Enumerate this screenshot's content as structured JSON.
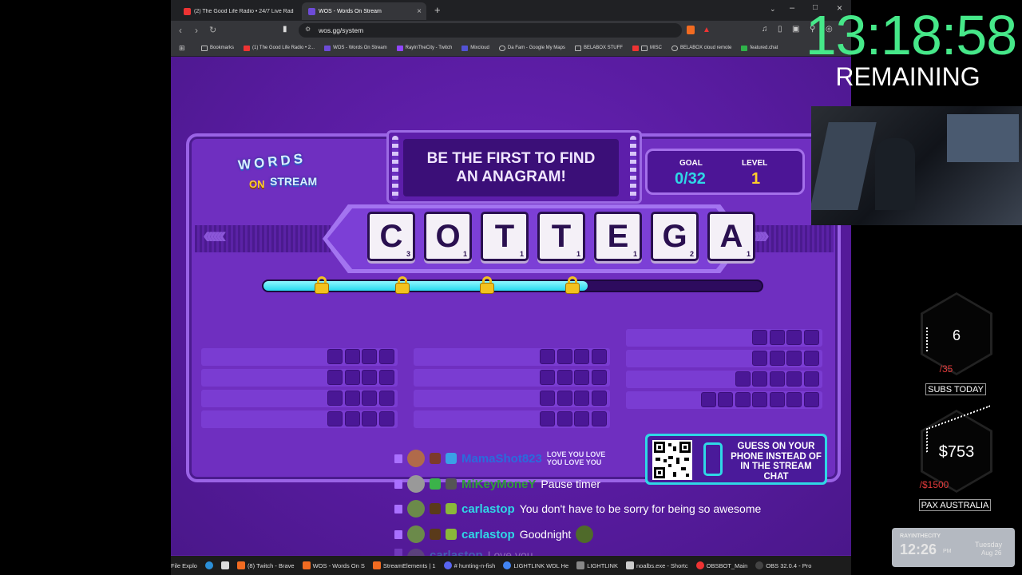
{
  "browser": {
    "tabs": [
      {
        "label": "(2) The Good Life Radio • 24/7 Live Radio | I",
        "active": false
      },
      {
        "label": "WOS - Words On Stream",
        "active": true
      }
    ],
    "new_tab_label": "+",
    "url": "wos.gg/system",
    "bookmarks": [
      "Bookmarks",
      "(1) The Good Life Radio • 2...",
      "WOS - Words On Stream",
      "RayInTheCity - Twitch",
      "Mixcloud",
      "Da Fam - Google My Maps",
      "BELABOX STUFF",
      "MISC",
      "BELABOX cloud remote",
      "featured.chat"
    ]
  },
  "game": {
    "logo_top": "WORDS",
    "logo_bottom_on": "ON",
    "logo_bottom_stream": "STREAM",
    "banner_text": "BE THE FIRST TO FIND AN ANAGRAM!",
    "goal_label": "GOAL",
    "goal_value": "0/32",
    "level_label": "LEVEL",
    "level_value": "1",
    "letters": [
      {
        "ch": "C",
        "pts": "3"
      },
      {
        "ch": "O",
        "pts": "1"
      },
      {
        "ch": "T",
        "pts": "1"
      },
      {
        "ch": "T",
        "pts": "1"
      },
      {
        "ch": "E",
        "pts": "1"
      },
      {
        "ch": "G",
        "pts": "2"
      },
      {
        "ch": "A",
        "pts": "1"
      }
    ],
    "progress_fraction": 0.65,
    "qr_text": "GUESS ON YOUR PHONE INSTEAD OF IN THE STREAM CHAT"
  },
  "chat": [
    {
      "user": "MamaShot823",
      "message": "LOVE YOU LOVE YOU LOVE YOU",
      "user_color": "#2a6bdc"
    },
    {
      "user": "MiKeyMoneY",
      "message": "Pause timer",
      "user_color": "#2f9e3a"
    },
    {
      "user": "carlastop",
      "message": "You don't have to be sorry for being so awesome",
      "user_color": "#2fd7e6"
    },
    {
      "user": "carlastop",
      "message": "Goodnight",
      "user_color": "#2fd7e6"
    },
    {
      "user": "carlastop",
      "message": "Love you",
      "user_color": "#2fd7e6"
    }
  ],
  "taskbar": [
    "File Explo",
    "(8) Twitch - Brave",
    "WOS - Words On S",
    "StreamElements | 1",
    "# hunting-n-fish",
    "LIGHTLINK WDL He",
    "LIGHTLINK",
    "noalbs.exe - Shortc",
    "OBSBOT_Main",
    "OBS 32.0.4 - Pro"
  ],
  "overlay": {
    "timer": "13:18:58",
    "remaining": "REMAINING",
    "subs_count": "6",
    "subs_goal": "/35",
    "subs_label": "SUBS TODAY",
    "money": "$753",
    "money_goal": "/$1500",
    "money_label": "PAX AUSTRALIA",
    "clock_brand": "RAYINTHECITY",
    "clock_time": "12:26",
    "clock_ampm": "PM",
    "clock_day": "Tuesday",
    "clock_date": "Aug 26"
  },
  "colors": {
    "timer_green": "#46e889",
    "game_purple": "#6f2fc0",
    "progress_cyan": "#26d8ee",
    "tile_bg": "#f4f0f7"
  }
}
